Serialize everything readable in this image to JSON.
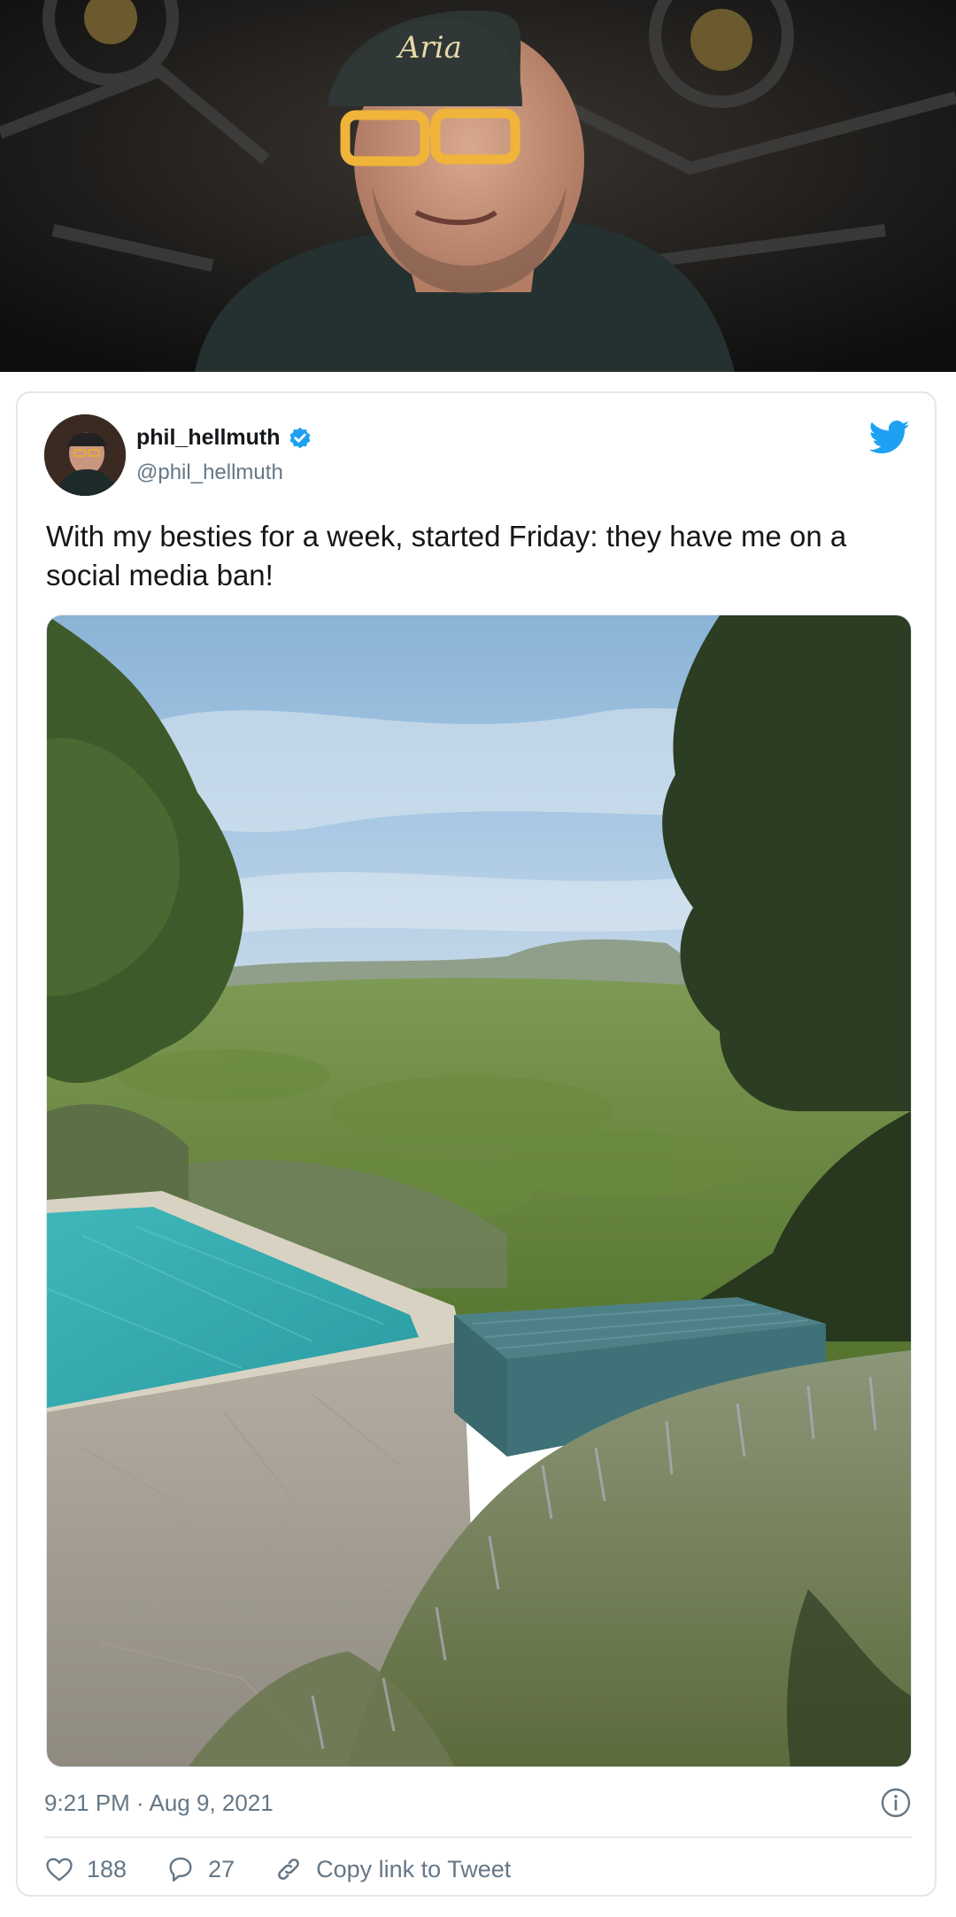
{
  "hero": {
    "cap_text": "Aria"
  },
  "tweet": {
    "display_name": "phil_hellmuth",
    "handle": "@phil_hellmuth",
    "text": "With my besties for a week, started Friday: they have me on a social media ban!",
    "timestamp": "9:21 PM · Aug 9, 2021",
    "likes": "188",
    "replies": "27",
    "copy_link_label": "Copy link to Tweet"
  },
  "icons": {
    "verified": "verified-badge-icon",
    "brand": "twitter-bird-icon",
    "info": "info-icon",
    "like": "heart-icon",
    "reply": "reply-icon",
    "link": "link-icon"
  },
  "colors": {
    "twitter_blue": "#1da1f2",
    "text_primary": "#14171a",
    "text_secondary": "#657786",
    "border": "#e1e8ed"
  }
}
